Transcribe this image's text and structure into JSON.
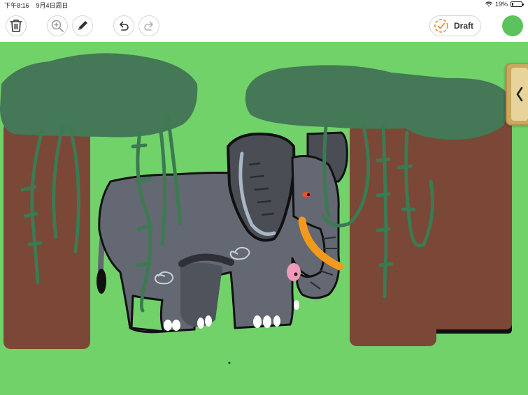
{
  "status_bar": {
    "time": "下午8:16",
    "date": "9月4日周日",
    "battery_percent": "19%",
    "battery_level": 0.19
  },
  "toolbar": {
    "delete_icon": "trash-icon",
    "zoom_icon": "zoom-in-icon",
    "pen_icon": "pencil-icon",
    "undo_icon": "undo-icon",
    "redo_icon": "redo-icon",
    "draft_label": "Draft",
    "draft_icon": "dashed-check-circle-icon",
    "done_icon": "done-circle-icon"
  },
  "side_tab": {
    "icon": "chevron-left-icon"
  },
  "colors": {
    "canvas_background": "#71d26a",
    "foliage": "#447856",
    "trunk": "#7b4737",
    "vine": "#3c7a52",
    "elephant_body": "#636872",
    "elephant_ear": "#4a4d54",
    "tusk": "#f39a1c",
    "toolbar_accent": "#e8892f",
    "done_button": "#5bc35b"
  }
}
